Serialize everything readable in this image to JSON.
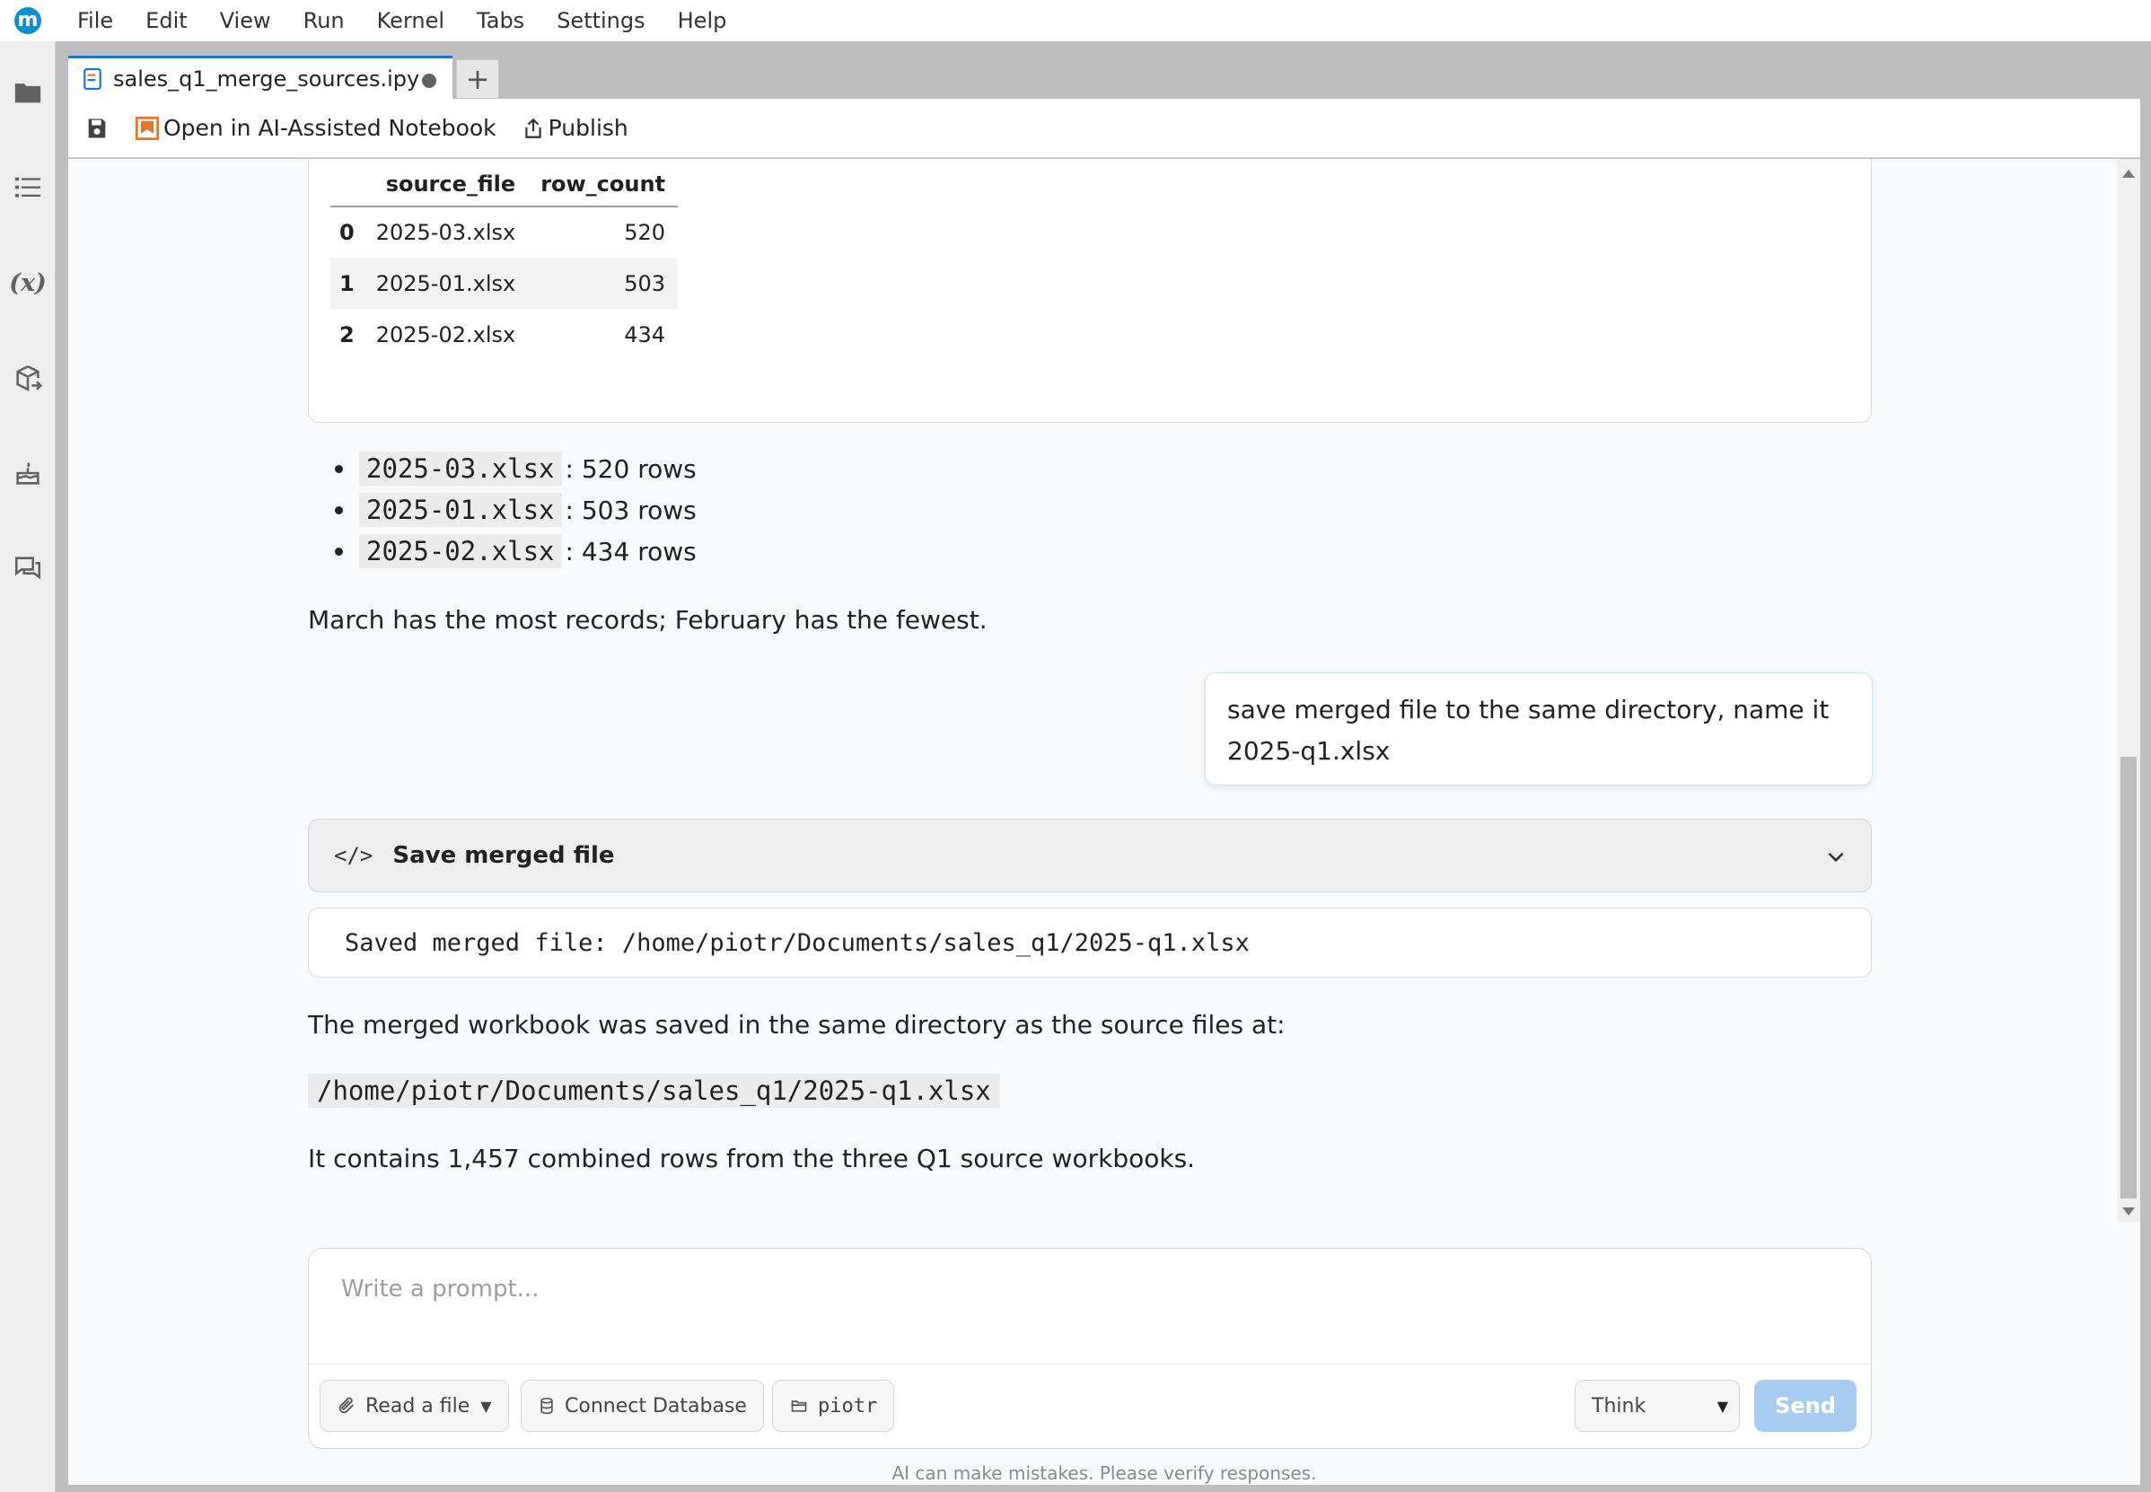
{
  "menubar": {
    "logo_letter": "m",
    "items": [
      "File",
      "Edit",
      "View",
      "Run",
      "Kernel",
      "Tabs",
      "Settings",
      "Help"
    ]
  },
  "sidebar": {
    "icons": [
      "folder-icon",
      "list-icon",
      "variable-icon",
      "package-export-icon",
      "cake-icon",
      "chat-icon"
    ],
    "variable_label": "(x)"
  },
  "tab": {
    "title": "sales_q1_merge_sources.ipy",
    "add_label": "+"
  },
  "toolbar": {
    "ai_label": "Open in AI-Assisted Notebook",
    "publish_label": "Publish"
  },
  "df_table": {
    "headers": [
      "",
      "source_file",
      "row_count"
    ],
    "rows": [
      {
        "idx": "0",
        "file": "2025-03.xlsx",
        "count": "520"
      },
      {
        "idx": "1",
        "file": "2025-01.xlsx",
        "count": "503"
      },
      {
        "idx": "2",
        "file": "2025-02.xlsx",
        "count": "434"
      }
    ]
  },
  "bullets": [
    {
      "code": "2025-03.xlsx",
      "text": ": 520 rows"
    },
    {
      "code": "2025-01.xlsx",
      "text": ": 503 rows"
    },
    {
      "code": "2025-02.xlsx",
      "text": ": 434 rows"
    }
  ],
  "summary_text": "March has the most records; February has the fewest.",
  "user_message": "save merged file to the same directory, name it 2025-q1.xlsx",
  "code_cell": {
    "icon": "</>",
    "title": "Save merged file"
  },
  "output_text": "Saved merged file: /home/piotr/Documents/sales_q1/2025-q1.xlsx",
  "response": {
    "line1": "The merged workbook was saved in the same directory as the source files at:",
    "path": "/home/piotr/Documents/sales_q1/2025-q1.xlsx",
    "line2": "It contains 1,457 combined rows from the three Q1 source workbooks."
  },
  "prompt": {
    "placeholder": "Write a prompt...",
    "read_file_label": "Read a file",
    "connect_db_label": "Connect Database",
    "dir_label": "piotr",
    "mode_label": "Think",
    "send_label": "Send",
    "disclaimer": "AI can make mistakes. Please verify responses."
  },
  "colors": {
    "accent": "#1976d2",
    "logo": "#0f8fd1",
    "send_disabled": "#a9cdf0",
    "ai_icon": "#e8742a"
  }
}
